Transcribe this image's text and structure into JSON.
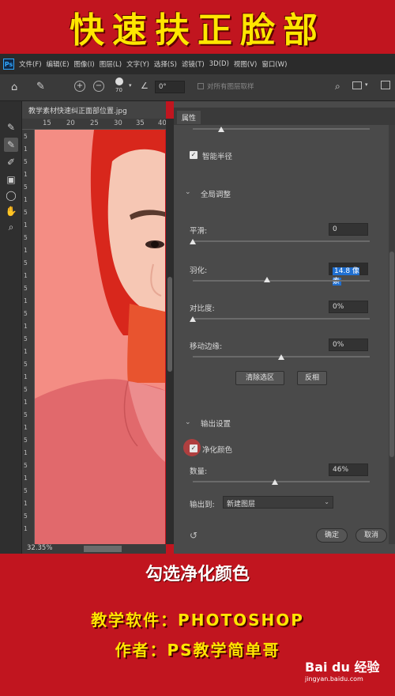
{
  "banner": {
    "title": "快速扶正脸部"
  },
  "menubar": {
    "logo": "Ps",
    "items": [
      "文件(F)",
      "编辑(E)",
      "图像(I)",
      "图层(L)",
      "文字(Y)",
      "选择(S)",
      "滤镜(T)",
      "3D(D)",
      "视图(V)",
      "窗口(W)"
    ]
  },
  "options": {
    "brush_size": "70",
    "angle": "0°",
    "sample_all_layers": "对所有图层取样"
  },
  "document": {
    "tab_title": "教学素材快速纠正面部位置.jpg",
    "ruler_h": [
      "15",
      "20",
      "25",
      "30",
      "35",
      "40"
    ],
    "ruler_v": [
      "5",
      "1",
      "5",
      "1",
      "5",
      "1",
      "5",
      "1",
      "5",
      "1",
      "5",
      "1",
      "5",
      "1",
      "5",
      "1",
      "5",
      "1",
      "5",
      "1",
      "5",
      "1",
      "5",
      "1",
      "5",
      "1",
      "5",
      "1",
      "5",
      "1",
      "5",
      "1",
      "5"
    ],
    "zoom": "32.35%"
  },
  "panel": {
    "tab": "属性",
    "smart_radius": "智能半径",
    "global_adjust": "全局调整",
    "smooth": {
      "label": "平滑:",
      "value": "0"
    },
    "feather": {
      "label": "羽化:",
      "value": "14.8 像素"
    },
    "contrast": {
      "label": "对比度:",
      "value": "0%"
    },
    "shift_edge": {
      "label": "移动边缘:",
      "value": "0%"
    },
    "clear_selection": "清除选区",
    "invert": "反相",
    "output_settings": "输出设置",
    "decontaminate": "净化颜色",
    "amount": {
      "label": "数量:",
      "value": "46%"
    },
    "output_to": {
      "label": "输出到:",
      "value": "新建图层"
    },
    "ok": "确定",
    "cancel": "取消"
  },
  "caption": "勾选净化颜色",
  "info": {
    "software": "教学软件：PHOTOSHOP",
    "author": "作者：PS教学简单哥"
  },
  "watermark": {
    "brand": "Bai du 经验",
    "url": "jingyan.baidu.com"
  },
  "colors": {
    "banner_red": "#c1151f",
    "title_yellow": "#ffe600",
    "overlay_pink": "#f48d84",
    "highlight_blue": "#1f6fd1"
  }
}
